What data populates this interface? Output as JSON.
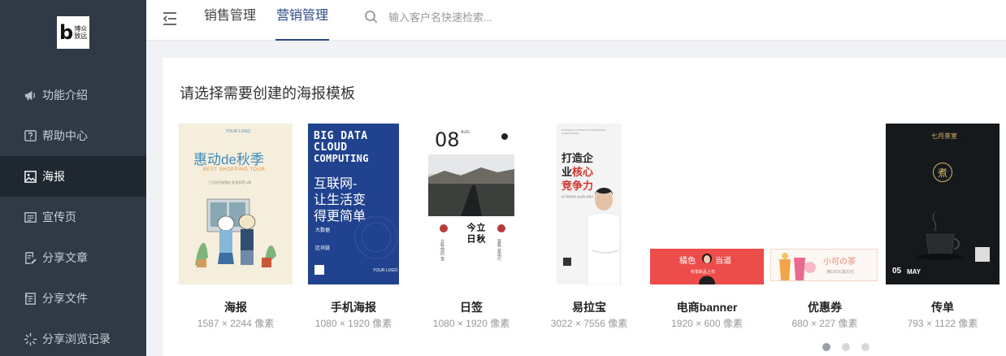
{
  "brand": {
    "logo_letter": "b",
    "logo_line1": "博众",
    "logo_line2": "致远"
  },
  "sidebar": {
    "items": [
      {
        "label": "功能介绍",
        "icon": "megaphone-icon",
        "active": false
      },
      {
        "label": "帮助中心",
        "icon": "help-icon",
        "active": false
      },
      {
        "label": "海报",
        "icon": "image-icon",
        "active": true
      },
      {
        "label": "宣传页",
        "icon": "page-icon",
        "active": false
      },
      {
        "label": "分享文章",
        "icon": "article-edit-icon",
        "active": false
      },
      {
        "label": "分享文件",
        "icon": "file-icon",
        "active": false
      },
      {
        "label": "分享浏览记录",
        "icon": "loading-icon",
        "active": false
      }
    ]
  },
  "header": {
    "tabs": [
      {
        "label": "销售管理",
        "active": false
      },
      {
        "label": "营销管理",
        "active": true
      }
    ],
    "search": {
      "placeholder": "输入客户名快速检索..."
    }
  },
  "main": {
    "title": "请选择需要创建的海报模板",
    "templates": [
      {
        "name": "海报",
        "size": "1587 × 2244 像素",
        "art": {
          "logo": "YOUR LOGO",
          "headline": "惠动de秋季",
          "sub": "BEST SHOPPING TOUR",
          "line": "三月份开放预定 秋游享受13折"
        }
      },
      {
        "name": "手机海报",
        "size": "1080 × 1920 像素",
        "art": {
          "line1": "BIG DATA",
          "line2": "CLOUD",
          "line3": "COMPUTING",
          "cn1": "互联网-",
          "cn2": "让生活变",
          "cn3": "得更简单",
          "tag1": "大数据",
          "tag2": "区块链",
          "logo": "YOUR LOGO"
        }
      },
      {
        "name": "日签",
        "size": "1080 × 1920 像素",
        "art": {
          "day": "08",
          "month": "AUG",
          "title1": "今日",
          "title2": "立秋",
          "col1": "立秋前后 宜",
          "col2": "宜祭 宜出行"
        }
      },
      {
        "name": "易拉宝",
        "size": "3022 × 7556 像素",
        "art": {
          "eng": "BUSINESS COURSE OF ENTERPRISE COMPETENCE",
          "line1": "打造企",
          "line2a": "业",
          "line2b": "核心",
          "line3": "竞争力",
          "sub": "热门商务培训 企业核心竞争力"
        }
      },
      {
        "name": "电商banner",
        "size": "1920 × 600 像素",
        "art": {
          "text1": "橘色",
          "text2": "当道",
          "sub": "秋季新品上市"
        }
      },
      {
        "name": "优惠券",
        "size": "680 × 227 像素",
        "art": {
          "title": "小可の茶",
          "sub": "满100元减20元"
        }
      },
      {
        "name": "传单",
        "size": "793 × 1122 像素",
        "art": {
          "top": "七月茶室",
          "seal": "煮",
          "date": "05",
          "month": "MAY"
        }
      }
    ],
    "pagination": {
      "pages": 3,
      "current": 1
    }
  },
  "colors": {
    "sidebar_bg": "#2f3a46",
    "sidebar_active_bg": "#1f2731",
    "accent": "#2b4a8b",
    "mobile_poster_bg": "#21438f",
    "ecom_red": "#ec4c4a",
    "flyer_bg": "#16191b"
  }
}
